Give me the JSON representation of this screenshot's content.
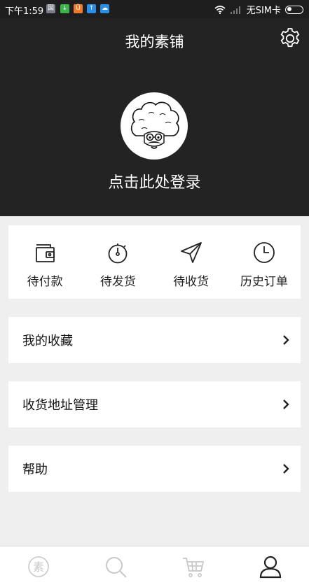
{
  "status_bar": {
    "time": "下午1:59",
    "carrier": "无SIM卡",
    "app_icons": [
      "app-icon-gray",
      "app-icon-green",
      "app-icon-orange",
      "app-icon-blue",
      "cloud-icon-blue"
    ]
  },
  "header": {
    "title": "我的素铺",
    "login_text": "点击此处登录"
  },
  "orders": [
    {
      "label": "待付款",
      "icon": "wallet-icon"
    },
    {
      "label": "待发货",
      "icon": "stopwatch-icon"
    },
    {
      "label": "待收货",
      "icon": "paper-plane-icon"
    },
    {
      "label": "历史订单",
      "icon": "clock-icon"
    }
  ],
  "menu": [
    {
      "label": "我的收藏"
    },
    {
      "label": "收货地址管理"
    },
    {
      "label": "帮助"
    }
  ],
  "bottom_nav": [
    {
      "name": "home",
      "icon": "su-logo-icon",
      "glyph": "素"
    },
    {
      "name": "search",
      "icon": "search-icon"
    },
    {
      "name": "cart",
      "icon": "cart-icon"
    },
    {
      "name": "profile",
      "icon": "user-icon"
    }
  ],
  "colors": {
    "header_bg": "#232323",
    "page_bg": "#efeff0",
    "text": "#222222",
    "inactive_icon": "#c8c8c8"
  }
}
